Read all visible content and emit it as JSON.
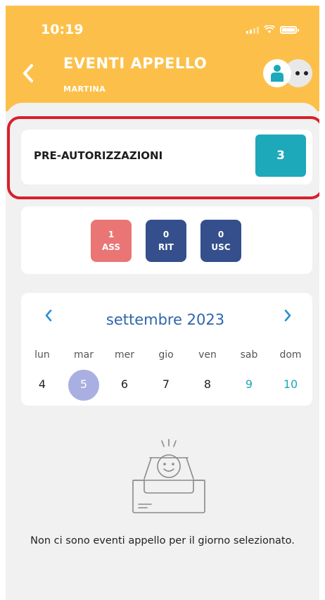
{
  "status_bar": {
    "time": "10:19"
  },
  "header": {
    "back_icon": "chevron-left-icon",
    "title": "EVENTI APPELLO",
    "subtitle": "MARTINA",
    "avatar_icon": "person-icon",
    "more_icon": "more-dots-icon"
  },
  "preauthorizations": {
    "label": "PRE-AUTORIZZAZIONI",
    "count": "3",
    "highlight_color": "#d8202a"
  },
  "badges": [
    {
      "value": "1",
      "label": "ASS",
      "color": "#ea7575"
    },
    {
      "value": "0",
      "label": "RIT",
      "color": "#344f8c"
    },
    {
      "value": "0",
      "label": "USC",
      "color": "#344f8c"
    }
  ],
  "calendar": {
    "month_label": "settembre 2023",
    "weekdays": [
      "lun",
      "mar",
      "mer",
      "gio",
      "ven",
      "sab",
      "dom"
    ],
    "days": [
      "4",
      "5",
      "6",
      "7",
      "8",
      "9",
      "10"
    ],
    "selected_day": "5"
  },
  "empty_state": {
    "icon": "empty-inbox-icon",
    "message": "Non ci sono eventi appello per il giorno selezionato."
  },
  "colors": {
    "header": "#fcc04a",
    "accent_teal": "#1da9b9",
    "calendar_title": "#2f65ad",
    "selected_day": "#a9afe0"
  }
}
